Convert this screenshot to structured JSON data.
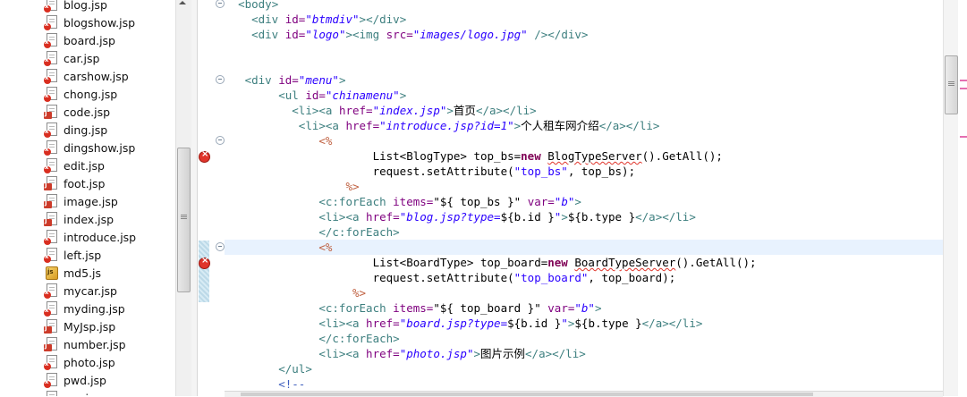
{
  "project_tree": {
    "files": [
      {
        "name": "blog.jsp",
        "kind": "jsp-error"
      },
      {
        "name": "blogshow.jsp",
        "kind": "jsp-error"
      },
      {
        "name": "board.jsp",
        "kind": "jsp-error"
      },
      {
        "name": "car.jsp",
        "kind": "jsp-error"
      },
      {
        "name": "carshow.jsp",
        "kind": "jsp-error"
      },
      {
        "name": "chong.jsp",
        "kind": "jsp-error"
      },
      {
        "name": "code.jsp",
        "kind": "jsp"
      },
      {
        "name": "ding.jsp",
        "kind": "jsp-error"
      },
      {
        "name": "dingshow.jsp",
        "kind": "jsp-error"
      },
      {
        "name": "edit.jsp",
        "kind": "jsp-error"
      },
      {
        "name": "foot.jsp",
        "kind": "jsp"
      },
      {
        "name": "image.jsp",
        "kind": "jsp"
      },
      {
        "name": "index.jsp",
        "kind": "jsp"
      },
      {
        "name": "introduce.jsp",
        "kind": "jsp-error"
      },
      {
        "name": "left.jsp",
        "kind": "jsp-error"
      },
      {
        "name": "md5.js",
        "kind": "js"
      },
      {
        "name": "mycar.jsp",
        "kind": "jsp-error"
      },
      {
        "name": "myding.jsp",
        "kind": "jsp-error"
      },
      {
        "name": "MyJsp.jsp",
        "kind": "jsp"
      },
      {
        "name": "number.jsp",
        "kind": "jsp"
      },
      {
        "name": "photo.jsp",
        "kind": "jsp-error"
      },
      {
        "name": "pwd.jsp",
        "kind": "jsp-error"
      },
      {
        "name": "reg.jsp",
        "kind": "jsp-error"
      }
    ]
  },
  "editor": {
    "error_lines": [
      10,
      17
    ],
    "fold_lines": [
      0,
      5,
      9,
      16
    ],
    "current_line": 16,
    "lines": [
      [
        {
          "t": "  ",
          "c": "txt"
        },
        {
          "t": "<body>",
          "c": "tg"
        }
      ],
      [
        {
          "t": "    ",
          "c": "txt"
        },
        {
          "t": "<div ",
          "c": "tg"
        },
        {
          "t": "id=",
          "c": "at"
        },
        {
          "t": "\"btmdiv\"",
          "c": "av"
        },
        {
          "t": "></div>",
          "c": "tg"
        }
      ],
      [
        {
          "t": "    ",
          "c": "txt"
        },
        {
          "t": "<div ",
          "c": "tg"
        },
        {
          "t": "id=",
          "c": "at"
        },
        {
          "t": "\"logo\"",
          "c": "av"
        },
        {
          "t": "><img ",
          "c": "tg"
        },
        {
          "t": "src=",
          "c": "at"
        },
        {
          "t": "\"images/logo.jpg\"",
          "c": "av"
        },
        {
          "t": " /></div>",
          "c": "tg"
        }
      ],
      [],
      [],
      [
        {
          "t": "   ",
          "c": "txt"
        },
        {
          "t": "<div ",
          "c": "tg"
        },
        {
          "t": "id=",
          "c": "at"
        },
        {
          "t": "\"menu\"",
          "c": "av"
        },
        {
          "t": ">",
          "c": "tg"
        }
      ],
      [
        {
          "t": "        ",
          "c": "txt"
        },
        {
          "t": "<ul ",
          "c": "tg"
        },
        {
          "t": "id=",
          "c": "at"
        },
        {
          "t": "\"chinamenu\"",
          "c": "av"
        },
        {
          "t": ">",
          "c": "tg"
        }
      ],
      [
        {
          "t": "          ",
          "c": "txt"
        },
        {
          "t": "<li><a ",
          "c": "tg"
        },
        {
          "t": "href=",
          "c": "at"
        },
        {
          "t": "\"index.jsp\"",
          "c": "av"
        },
        {
          "t": ">",
          "c": "tg"
        },
        {
          "t": "首页",
          "c": "txt"
        },
        {
          "t": "</a></li>",
          "c": "tg"
        }
      ],
      [
        {
          "t": "           ",
          "c": "txt"
        },
        {
          "t": "<li><a ",
          "c": "tg"
        },
        {
          "t": "href=",
          "c": "at"
        },
        {
          "t": "\"introduce.jsp?id=1\"",
          "c": "av"
        },
        {
          "t": ">",
          "c": "tg"
        },
        {
          "t": "个人租车网介绍",
          "c": "txt"
        },
        {
          "t": "</a></li>",
          "c": "tg"
        }
      ],
      [
        {
          "t": "              ",
          "c": "txt"
        },
        {
          "t": "<%",
          "c": "jsp"
        }
      ],
      [
        {
          "t": "                      ",
          "c": "txt"
        },
        {
          "t": "List<BlogType> top_bs=",
          "c": "txt"
        },
        {
          "t": "new",
          "c": "kw"
        },
        {
          "t": " ",
          "c": "txt"
        },
        {
          "t": "BlogTypeServer",
          "c": "squig"
        },
        {
          "t": "().GetAll();",
          "c": "txt"
        }
      ],
      [
        {
          "t": "                      ",
          "c": "txt"
        },
        {
          "t": "request.setAttribute(",
          "c": "txt"
        },
        {
          "t": "\"top_bs\"",
          "c": "st"
        },
        {
          "t": ", top_bs);",
          "c": "txt"
        }
      ],
      [
        {
          "t": "                  ",
          "c": "txt"
        },
        {
          "t": "%>",
          "c": "jsp"
        }
      ],
      [
        {
          "t": "              ",
          "c": "txt"
        },
        {
          "t": "<c:forEach ",
          "c": "tg"
        },
        {
          "t": "items=",
          "c": "at"
        },
        {
          "t": "\"${ top_bs }\"",
          "c": "txt"
        },
        {
          "t": " ",
          "c": "txt"
        },
        {
          "t": "var=",
          "c": "at"
        },
        {
          "t": "\"b\"",
          "c": "av"
        },
        {
          "t": ">",
          "c": "tg"
        }
      ],
      [
        {
          "t": "              ",
          "c": "txt"
        },
        {
          "t": "<li><a ",
          "c": "tg"
        },
        {
          "t": "href=",
          "c": "at"
        },
        {
          "t": "\"blog.jsp?type=",
          "c": "av"
        },
        {
          "t": "${b.id }",
          "c": "txt"
        },
        {
          "t": "\"",
          "c": "av"
        },
        {
          "t": ">",
          "c": "tg"
        },
        {
          "t": "${b.type }",
          "c": "txt"
        },
        {
          "t": "</a></li>",
          "c": "tg"
        }
      ],
      [
        {
          "t": "              ",
          "c": "txt"
        },
        {
          "t": "</c:forEach>",
          "c": "tg"
        }
      ],
      [
        {
          "t": "              ",
          "c": "txt"
        },
        {
          "t": "<%",
          "c": "jsp"
        }
      ],
      [
        {
          "t": "                      ",
          "c": "txt"
        },
        {
          "t": "List<BoardType> top_board=",
          "c": "txt"
        },
        {
          "t": "new",
          "c": "kw"
        },
        {
          "t": " ",
          "c": "txt"
        },
        {
          "t": "BoardTypeServer",
          "c": "squig"
        },
        {
          "t": "().GetAll();",
          "c": "txt"
        }
      ],
      [
        {
          "t": "                      ",
          "c": "txt"
        },
        {
          "t": "request.setAttribute(",
          "c": "txt"
        },
        {
          "t": "\"top_board\"",
          "c": "st"
        },
        {
          "t": ", top_board);",
          "c": "txt"
        }
      ],
      [
        {
          "t": "                   ",
          "c": "txt"
        },
        {
          "t": "%>",
          "c": "jsp"
        }
      ],
      [
        {
          "t": "              ",
          "c": "txt"
        },
        {
          "t": "<c:forEach ",
          "c": "tg"
        },
        {
          "t": "items=",
          "c": "at"
        },
        {
          "t": "\"${ top_board }\"",
          "c": "txt"
        },
        {
          "t": " ",
          "c": "txt"
        },
        {
          "t": "var=",
          "c": "at"
        },
        {
          "t": "\"b\"",
          "c": "av"
        },
        {
          "t": ">",
          "c": "tg"
        }
      ],
      [
        {
          "t": "              ",
          "c": "txt"
        },
        {
          "t": "<li><a ",
          "c": "tg"
        },
        {
          "t": "href=",
          "c": "at"
        },
        {
          "t": "\"board.jsp?type=",
          "c": "av"
        },
        {
          "t": "${b.id }",
          "c": "txt"
        },
        {
          "t": "\"",
          "c": "av"
        },
        {
          "t": ">",
          "c": "tg"
        },
        {
          "t": "${b.type }",
          "c": "txt"
        },
        {
          "t": "</a></li>",
          "c": "tg"
        }
      ],
      [
        {
          "t": "              ",
          "c": "txt"
        },
        {
          "t": "</c:forEach>",
          "c": "tg"
        }
      ],
      [
        {
          "t": "              ",
          "c": "txt"
        },
        {
          "t": "<li><a ",
          "c": "tg"
        },
        {
          "t": "href=",
          "c": "at"
        },
        {
          "t": "\"photo.jsp\"",
          "c": "av"
        },
        {
          "t": ">",
          "c": "tg"
        },
        {
          "t": "图片示例",
          "c": "txt"
        },
        {
          "t": "</a></li>",
          "c": "tg"
        }
      ],
      [
        {
          "t": "        ",
          "c": "txt"
        },
        {
          "t": "</ul>",
          "c": "tg"
        }
      ],
      [
        {
          "t": "        ",
          "c": "txt"
        },
        {
          "t": "<!--",
          "c": "cm"
        }
      ]
    ]
  }
}
